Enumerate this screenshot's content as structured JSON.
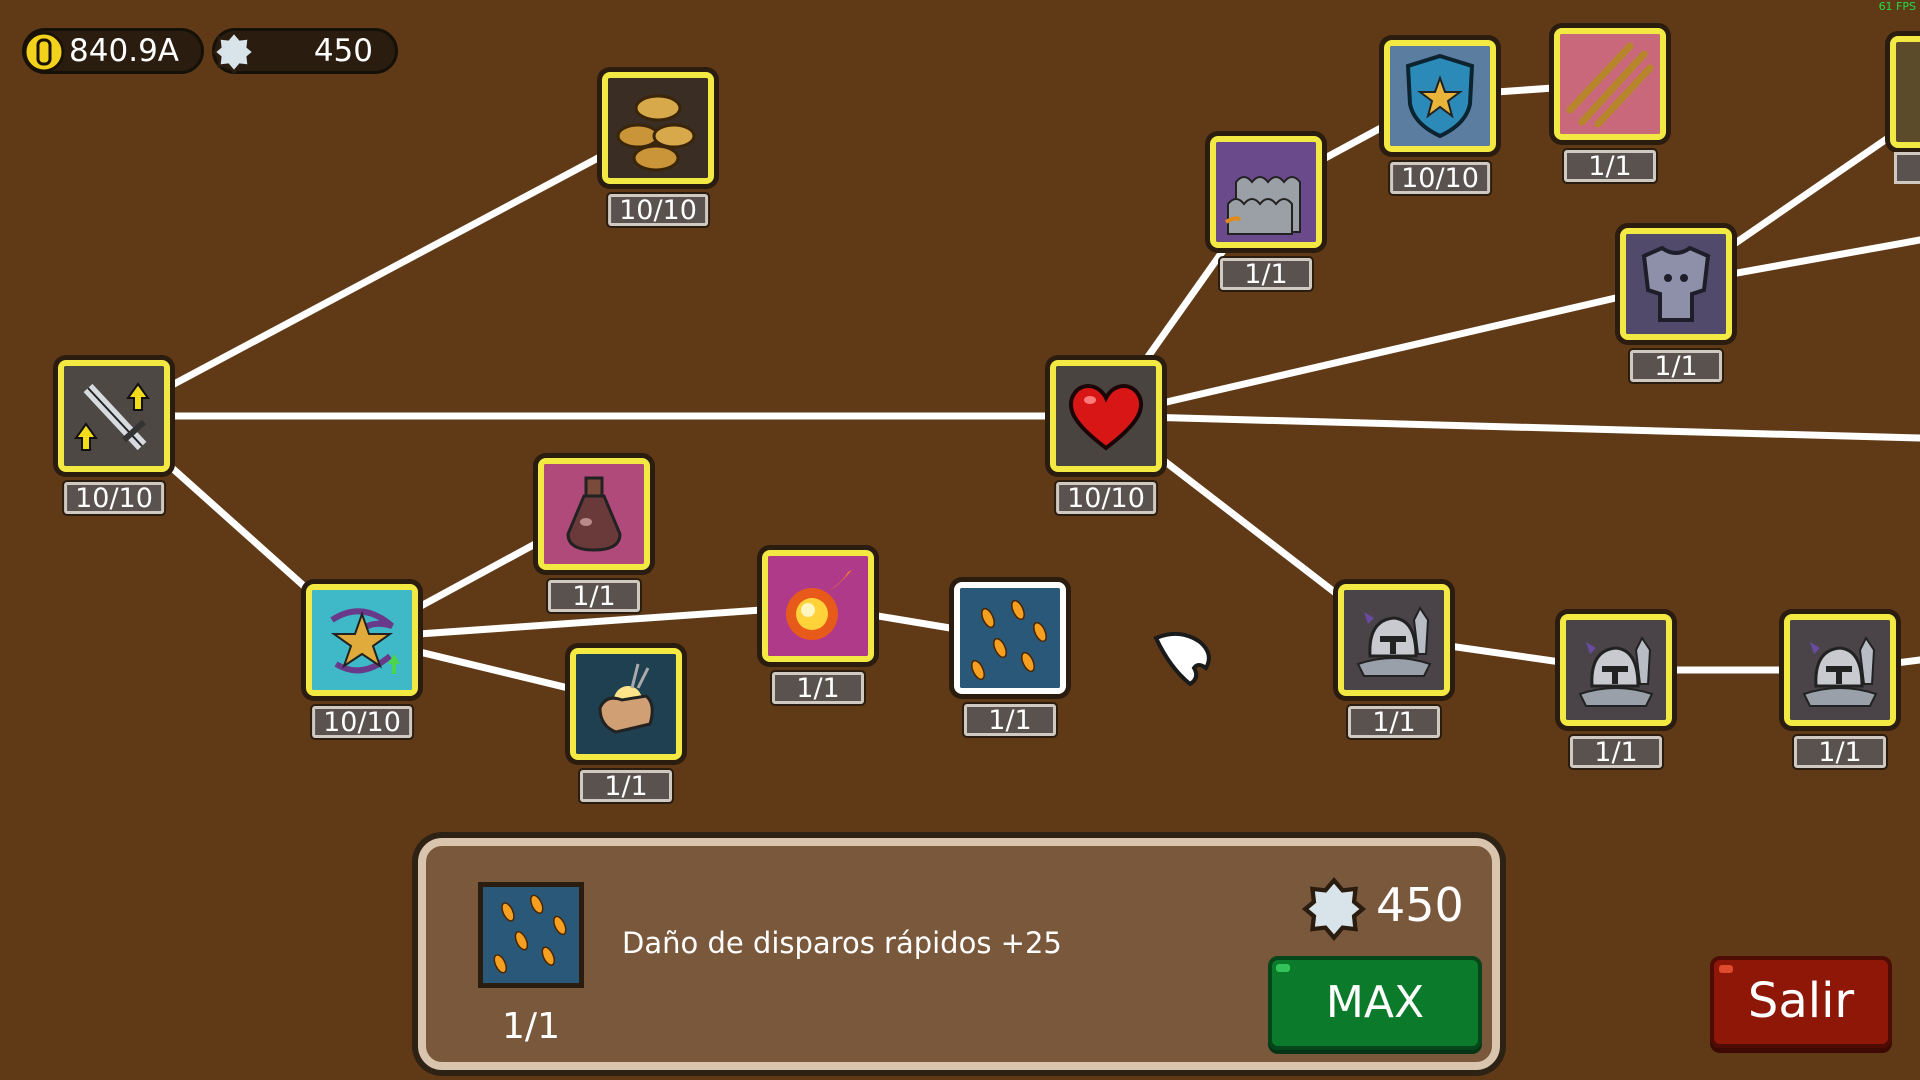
{
  "hud": {
    "gold": "840.9A",
    "gems": "450",
    "fps": "61 FPS"
  },
  "nodes": [
    {
      "id": "sword",
      "icon": "sword-upgrade-icon",
      "level": "10/10"
    },
    {
      "id": "coins",
      "icon": "coins-icon",
      "level": "10/10"
    },
    {
      "id": "heart",
      "icon": "heart-icon",
      "level": "10/10"
    },
    {
      "id": "scales",
      "icon": "dragon-scales-icon",
      "level": "1/1"
    },
    {
      "id": "shield",
      "icon": "star-shield-icon",
      "level": "10/10"
    },
    {
      "id": "claws",
      "icon": "claw-slash-icon",
      "level": "1/1"
    },
    {
      "id": "armor",
      "icon": "chest-armor-icon",
      "level": "1/1"
    },
    {
      "id": "star",
      "icon": "spinning-star-icon",
      "level": "10/10"
    },
    {
      "id": "potion",
      "icon": "potion-flask-icon",
      "level": "1/1"
    },
    {
      "id": "fist",
      "icon": "power-fist-icon",
      "level": "1/1"
    },
    {
      "id": "fireball",
      "icon": "fireball-icon",
      "level": "1/1"
    },
    {
      "id": "meteor",
      "icon": "fire-rain-icon",
      "level": "1/1"
    },
    {
      "id": "knight1",
      "icon": "knight-helmet-icon",
      "level": "1/1"
    },
    {
      "id": "knight2",
      "icon": "knight-helmet-icon",
      "level": "1/1"
    },
    {
      "id": "knight3",
      "icon": "knight-helmet-icon",
      "level": "1/1"
    }
  ],
  "panel": {
    "icon": "fire-rain-icon",
    "level": "1/1",
    "description": "Daño de disparos rápidos +25",
    "cost": "450",
    "button": "MAX"
  },
  "exit_button": "Salir",
  "colors": {
    "background": "#603a16",
    "node_border": "#f2ea43",
    "link": "#ffffff",
    "max_button": "#0b7a2a",
    "exit_button": "#8e1708"
  }
}
